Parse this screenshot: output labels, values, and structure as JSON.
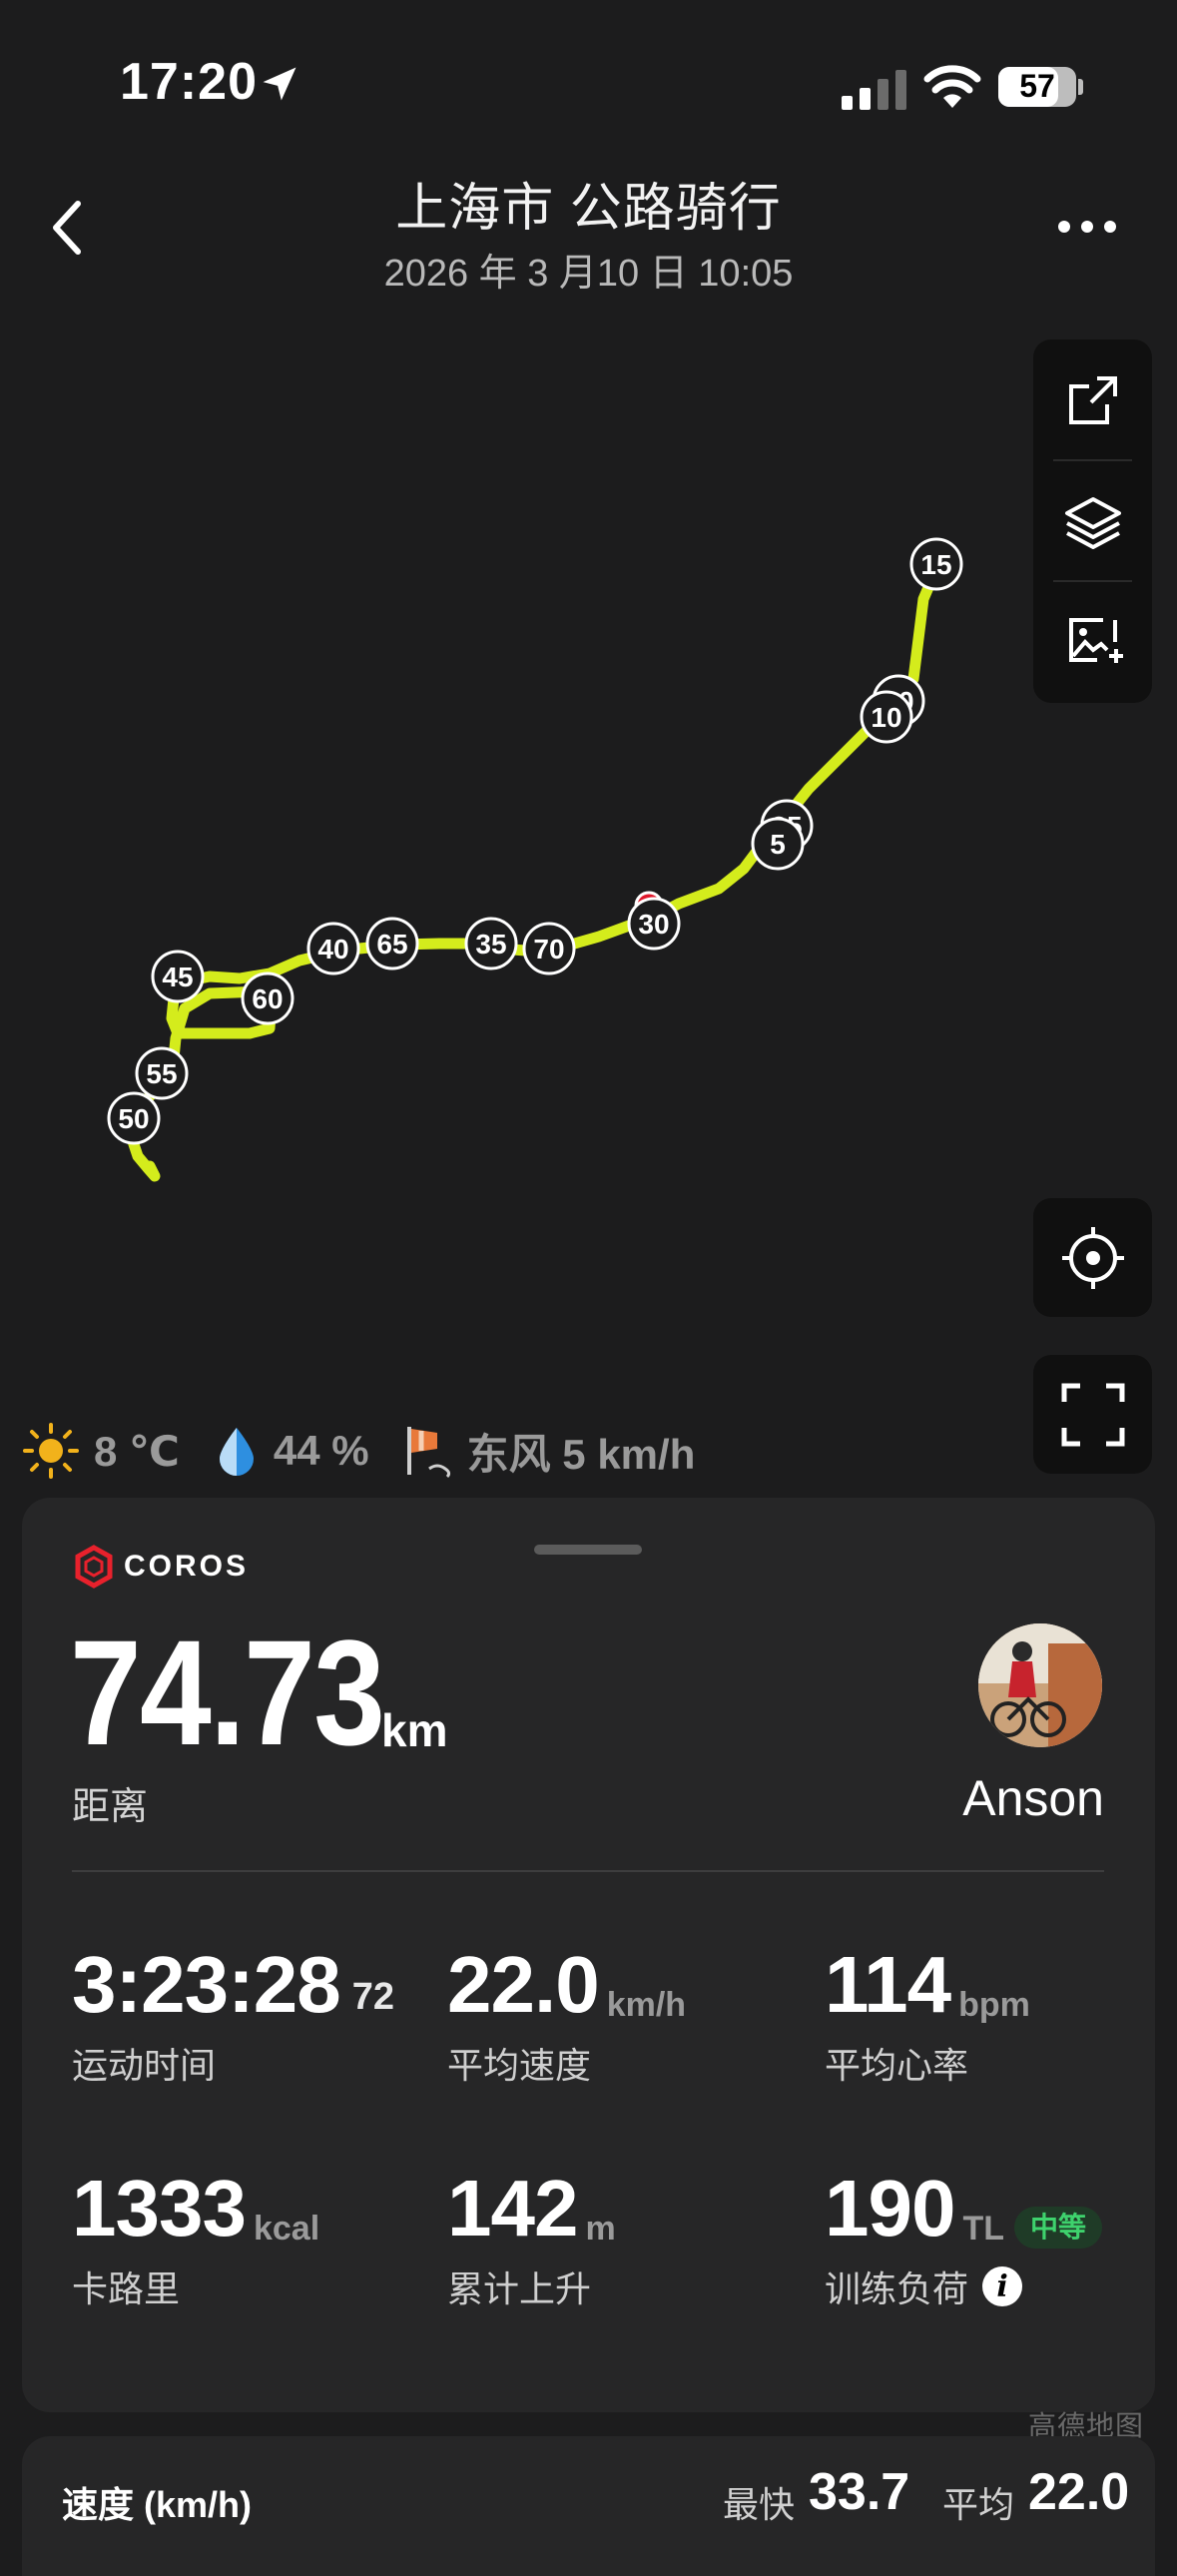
{
  "status_bar": {
    "time": "17:20",
    "battery": "57"
  },
  "header": {
    "title": "上海市 公路骑行",
    "subtitle": "2026 年 3 月10 日 10:05"
  },
  "map": {
    "route_color": "#d4ec1c",
    "km_markers": [
      "15",
      "20",
      "10",
      "25",
      "5",
      "30",
      "70",
      "35",
      "65",
      "40",
      "60",
      "45",
      "55",
      "50"
    ]
  },
  "weather": {
    "temperature": "8 ℃",
    "humidity": "44 %",
    "wind": "东风 5 km/h"
  },
  "card": {
    "brand": "COROS",
    "distance_value": "74.73",
    "distance_unit": "km",
    "distance_label": "距离",
    "user_name": "Anson",
    "stats": [
      {
        "value": "3:23:28",
        "sup": "72",
        "unit": "",
        "label": "运动时间"
      },
      {
        "value": "22.0",
        "unit": "km/h",
        "label": "平均速度"
      },
      {
        "value": "114",
        "unit": "bpm",
        "label": "平均心率"
      },
      {
        "value": "1333",
        "unit": "kcal",
        "label": "卡路里"
      },
      {
        "value": "142",
        "unit": "m",
        "label": "累计上升"
      },
      {
        "value": "190",
        "unit": "TL",
        "badge": "中等",
        "label": "训练负荷"
      }
    ]
  },
  "speed": {
    "title": "速度 (km/h)",
    "max_label": "最快",
    "max_value": "33.7",
    "avg_label": "平均",
    "avg_value": "22.0"
  },
  "watermark": "高德地图"
}
